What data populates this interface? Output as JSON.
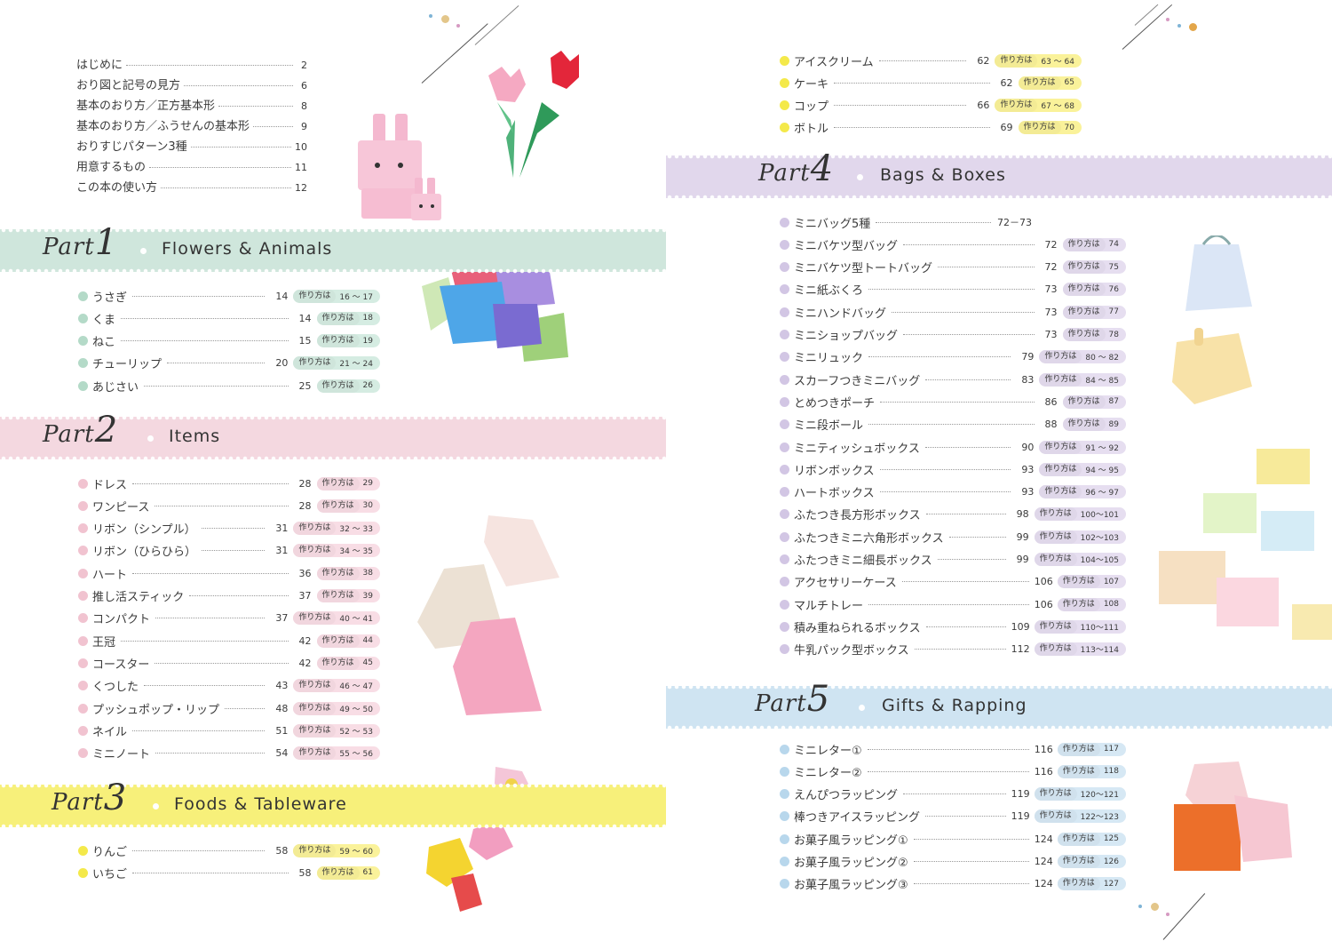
{
  "intro": [
    {
      "title": "はじめに",
      "page": "2"
    },
    {
      "title": "おり図と記号の見方",
      "page": "6"
    },
    {
      "title": "基本のおり方／正方基本形",
      "page": "8"
    },
    {
      "title": "基本のおり方／ふうせんの基本形",
      "page": "9"
    },
    {
      "title": "おりすじパターン3種",
      "page": "10"
    },
    {
      "title": "用意するもの",
      "page": "11"
    },
    {
      "title": "この本の使い方",
      "page": "12"
    }
  ],
  "how_to_label": "作り方は",
  "parts": [
    {
      "id": "p1",
      "part_word": "Part",
      "part_num": "1",
      "title": "Flowers & Animals",
      "band_color": "#cfe6dc",
      "bullet_color": "#b4dac8",
      "pill_color": "#d5ece2",
      "items": [
        {
          "name": "うさぎ",
          "page": "14",
          "how": "16 ～ 17"
        },
        {
          "name": "くま",
          "page": "14",
          "how": "18"
        },
        {
          "name": "ねこ",
          "page": "15",
          "how": "19"
        },
        {
          "name": "チューリップ",
          "page": "20",
          "how": "21 ～ 24"
        },
        {
          "name": "あじさい",
          "page": "25",
          "how": "26"
        }
      ]
    },
    {
      "id": "p2",
      "part_word": "Part",
      "part_num": "2",
      "title": "Items",
      "band_color": "#f4d8e0",
      "bullet_color": "#f1c3d0",
      "pill_color": "#f8dde5",
      "items": [
        {
          "name": "ドレス",
          "page": "28",
          "how": "29"
        },
        {
          "name": "ワンピース",
          "page": "28",
          "how": "30"
        },
        {
          "name": "リボン（シンプル）",
          "page": "31",
          "how": "32 ～ 33"
        },
        {
          "name": "リボン（ひらひら）",
          "page": "31",
          "how": "34 ～ 35"
        },
        {
          "name": "ハート",
          "page": "36",
          "how": "38"
        },
        {
          "name": "推し活スティック",
          "page": "37",
          "how": "39"
        },
        {
          "name": "コンパクト",
          "page": "37",
          "how": "40 ～ 41"
        },
        {
          "name": "王冠",
          "page": "42",
          "how": "44"
        },
        {
          "name": "コースター",
          "page": "42",
          "how": "45"
        },
        {
          "name": "くつした",
          "page": "43",
          "how": "46 ～ 47"
        },
        {
          "name": "プッシュポップ・リップ",
          "page": "48",
          "how": "49 ～ 50"
        },
        {
          "name": "ネイル",
          "page": "51",
          "how": "52 ～ 53"
        },
        {
          "name": "ミニノート",
          "page": "54",
          "how": "55 ～ 56"
        }
      ]
    },
    {
      "id": "p3",
      "part_word": "Part",
      "part_num": "3",
      "title": "Foods & Tableware",
      "band_color": "#f7f07a",
      "bullet_color": "#f4e94a",
      "pill_color": "#faf29a",
      "items": [
        {
          "name": "りんご",
          "page": "58",
          "how": "59 ～ 60"
        },
        {
          "name": "いちご",
          "page": "58",
          "how": "61"
        }
      ],
      "items_cont": [
        {
          "name": "アイスクリーム",
          "page": "62",
          "how": "63 ～ 64"
        },
        {
          "name": "ケーキ",
          "page": "62",
          "how": "65"
        },
        {
          "name": "コップ",
          "page": "66",
          "how": "67 ～ 68"
        },
        {
          "name": "ボトル",
          "page": "69",
          "how": "70"
        }
      ]
    },
    {
      "id": "p4",
      "part_word": "Part",
      "part_num": "4",
      "title": "Bags & Boxes",
      "band_color": "#e1d7ec",
      "bullet_color": "#d2c6e4",
      "pill_color": "#e6def0",
      "items": [
        {
          "name": "ミニバッグ5種",
          "page": "72－73",
          "how": ""
        },
        {
          "name": "ミニバケツ型バッグ",
          "page": "72",
          "how": "74"
        },
        {
          "name": "ミニバケツ型トートバッグ",
          "page": "72",
          "how": "75"
        },
        {
          "name": "ミニ紙ぶくろ",
          "page": "73",
          "how": "76"
        },
        {
          "name": "ミニハンドバッグ",
          "page": "73",
          "how": "77"
        },
        {
          "name": "ミニショップバッグ",
          "page": "73",
          "how": "78"
        },
        {
          "name": "ミニリュック",
          "page": "79",
          "how": "80 ～ 82"
        },
        {
          "name": "スカーフつきミニバッグ",
          "page": "83",
          "how": "84 ～ 85"
        },
        {
          "name": "とめつきポーチ",
          "page": "86",
          "how": "87"
        },
        {
          "name": "ミニ段ボール",
          "page": "88",
          "how": "89"
        },
        {
          "name": "ミニティッシュボックス",
          "page": "90",
          "how": "91 ～ 92"
        },
        {
          "name": "リボンボックス",
          "page": "93",
          "how": "94 ～ 95"
        },
        {
          "name": "ハートボックス",
          "page": "93",
          "how": "96 ～ 97"
        },
        {
          "name": "ふたつき長方形ボックス",
          "page": "98",
          "how": "100～101"
        },
        {
          "name": "ふたつきミニ六角形ボックス",
          "page": "99",
          "how": "102～103"
        },
        {
          "name": "ふたつきミニ細長ボックス",
          "page": "99",
          "how": "104～105"
        },
        {
          "name": "アクセサリーケース",
          "page": "106",
          "how": "107"
        },
        {
          "name": "マルチトレー",
          "page": "106",
          "how": "108"
        },
        {
          "name": "積み重ねられるボックス",
          "page": "109",
          "how": "110～111"
        },
        {
          "name": "牛乳パック型ボックス",
          "page": "112",
          "how": "113～114"
        }
      ]
    },
    {
      "id": "p5",
      "part_word": "Part",
      "part_num": "5",
      "title": "Gifts & Rapping",
      "band_color": "#cfe4f2",
      "bullet_color": "#b8d7ec",
      "pill_color": "#d6e8f4",
      "items": [
        {
          "name": "ミニレター①",
          "page": "116",
          "how": "117"
        },
        {
          "name": "ミニレター②",
          "page": "116",
          "how": "118"
        },
        {
          "name": "えんぴつラッピング",
          "page": "119",
          "how": "120～121"
        },
        {
          "name": "棒つきアイスラッピング",
          "page": "119",
          "how": "122～123"
        },
        {
          "name": "お菓子風ラッピング①",
          "page": "124",
          "how": "125"
        },
        {
          "name": "お菓子風ラッピング②",
          "page": "124",
          "how": "126"
        },
        {
          "name": "お菓子風ラッピング③",
          "page": "124",
          "how": "127"
        }
      ]
    }
  ]
}
